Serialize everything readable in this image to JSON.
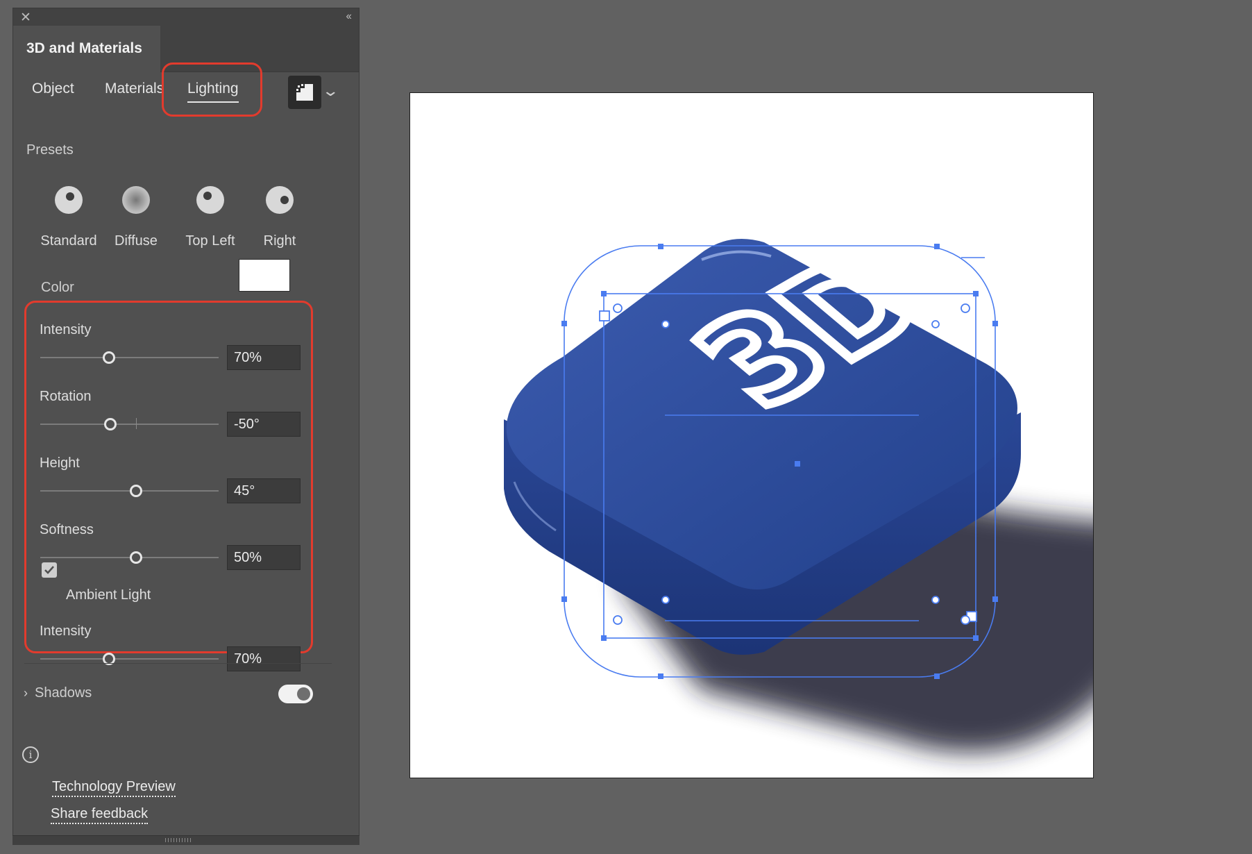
{
  "panel": {
    "title": "3D and Materials",
    "tabs": [
      {
        "label": "Object",
        "active": false
      },
      {
        "label": "Materials",
        "active": false
      },
      {
        "label": "Lighting",
        "active": true
      }
    ],
    "presets_heading": "Presets",
    "presets": [
      {
        "label": "Standard",
        "icon": "standard-light-icon"
      },
      {
        "label": "Diffuse",
        "icon": "diffuse-light-icon"
      },
      {
        "label": "Top Left",
        "icon": "top-left-light-icon"
      },
      {
        "label": "Right",
        "icon": "right-light-icon"
      }
    ],
    "color_label": "Color",
    "color_value": "#ffffff",
    "intensity": {
      "label": "Intensity",
      "value": "70%",
      "level": 0.7
    },
    "rotation": {
      "label": "Rotation",
      "value": "-50°",
      "level": -50
    },
    "height": {
      "label": "Height",
      "value": "45°",
      "level": 45
    },
    "softness": {
      "label": "Softness",
      "value": "50%",
      "level": 0.5
    },
    "ambient": {
      "label": "Ambient Light",
      "checked": true
    },
    "ambient_intensity": {
      "label": "Intensity",
      "value": "70%",
      "level": 0.7
    },
    "shadows": {
      "label": "Shadows",
      "enabled": true
    },
    "links": {
      "technology_preview": "Technology Preview",
      "share_feedback": "Share feedback"
    }
  },
  "colors": {
    "highlight": "#e23b2d",
    "selection": "#4a7cf0",
    "object_blue": "#2f4f9e"
  },
  "canvas": {
    "object_text": "3D"
  }
}
